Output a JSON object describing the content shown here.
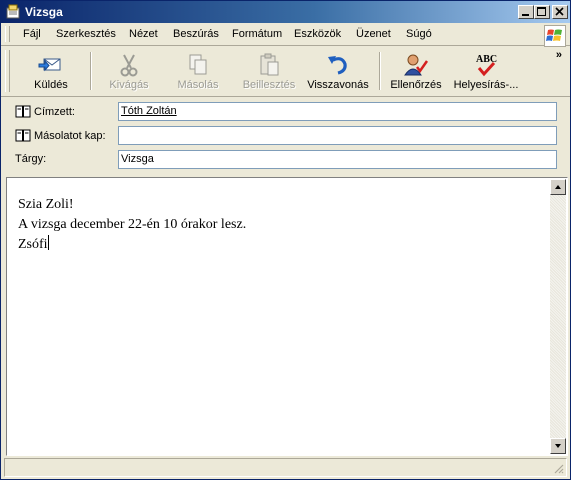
{
  "window": {
    "title": "Vizsga"
  },
  "menu": [
    "Fájl",
    "Szerkesztés",
    "Nézet",
    "Beszúrás",
    "Formátum",
    "Eszközök",
    "Üzenet",
    "Súgó"
  ],
  "toolbar": {
    "send": "Küldés",
    "cut": "Kivágás",
    "copy": "Másolás",
    "paste": "Beillesztés",
    "undo": "Visszavonás",
    "check": "Ellenőrzés",
    "spelling": "Helyesírás-...",
    "more": "»"
  },
  "headers": {
    "to_label": "Címzett:",
    "to_value": "Tóth Zoltán",
    "cc_label": "Másolatot kap:",
    "cc_value": "",
    "subject_label": "Tárgy:",
    "subject_value": "Vizsga"
  },
  "message": {
    "line1": "Szia Zoli!",
    "line2": "A vizsga december 22-én 10 órakor lesz.",
    "line3": "Zsófi"
  },
  "colors": {
    "title_start": "#0a246a",
    "title_end": "#a6caf0",
    "undo_blue": "#1f5fbf",
    "check_red": "#d42020"
  }
}
